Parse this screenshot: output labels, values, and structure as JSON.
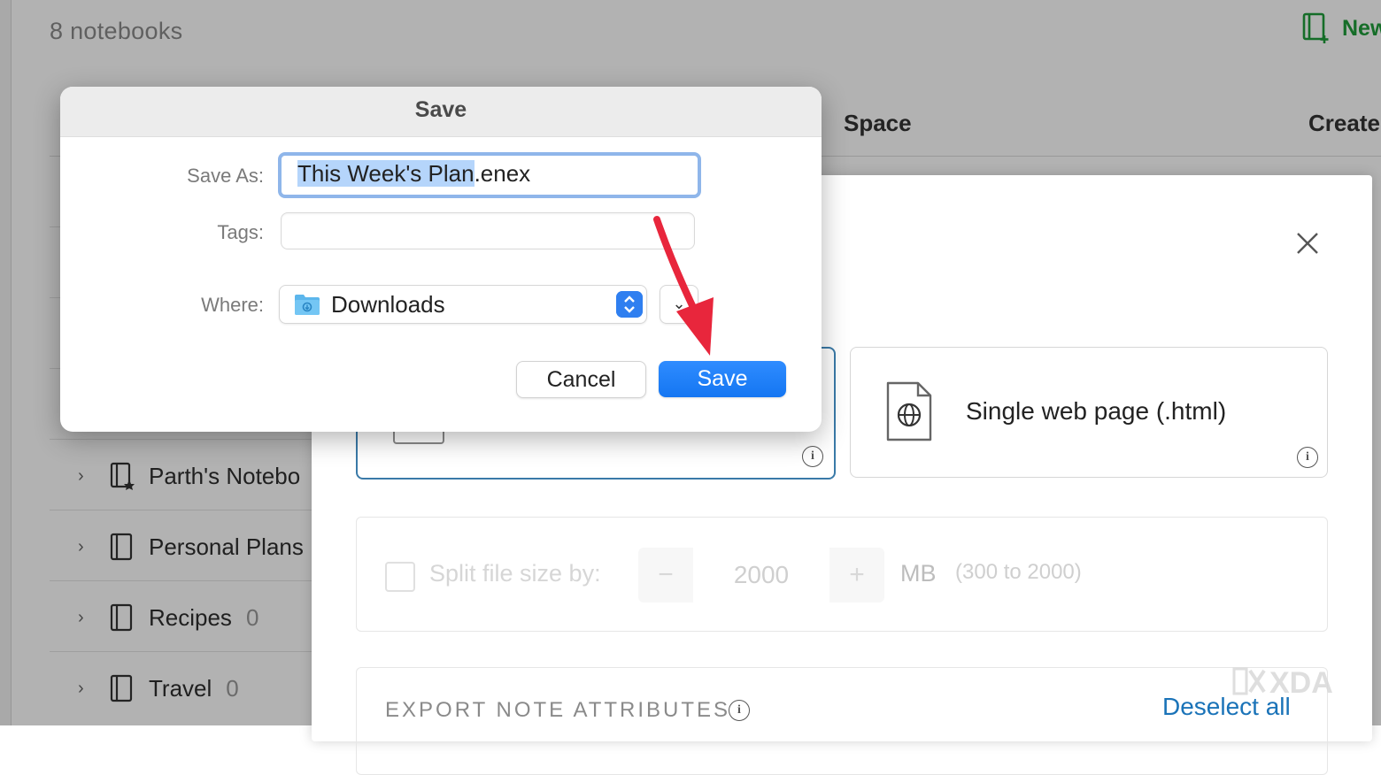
{
  "app": {
    "notebook_count": "8 notebooks",
    "new_button_label": "New",
    "columns": {
      "space": "Space",
      "created": "Create"
    },
    "notebooks": [
      {
        "name": "Parth's Notebo",
        "count": "",
        "starred": true
      },
      {
        "name": "Personal Plans",
        "count": ""
      },
      {
        "name": "Recipes",
        "count": "0"
      },
      {
        "name": "Travel",
        "count": "0"
      }
    ],
    "accent_color": "#1f9d3a"
  },
  "export_dialog": {
    "format_html_label": "Single web page (.html)",
    "split_label": "Split file size by:",
    "split_minus": "−",
    "split_value": "2000",
    "split_plus": "+",
    "split_unit": "MB",
    "split_range": "(300 to 2000)",
    "attributes_label": "EXPORT NOTE ATTRIBUTES",
    "deselect_all": "Deselect all",
    "info_glyph": "i"
  },
  "save_sheet": {
    "title": "Save",
    "save_as_label": "Save As:",
    "file_name_selected": "This Week's Plan",
    "file_extension": ".enex",
    "tags_label": "Tags:",
    "tags_value": "",
    "where_label": "Where:",
    "where_value": "Downloads",
    "cancel_label": "Cancel",
    "save_label": "Save",
    "primary_color": "#1a7ef5"
  },
  "watermark": {
    "text": "XDA"
  }
}
